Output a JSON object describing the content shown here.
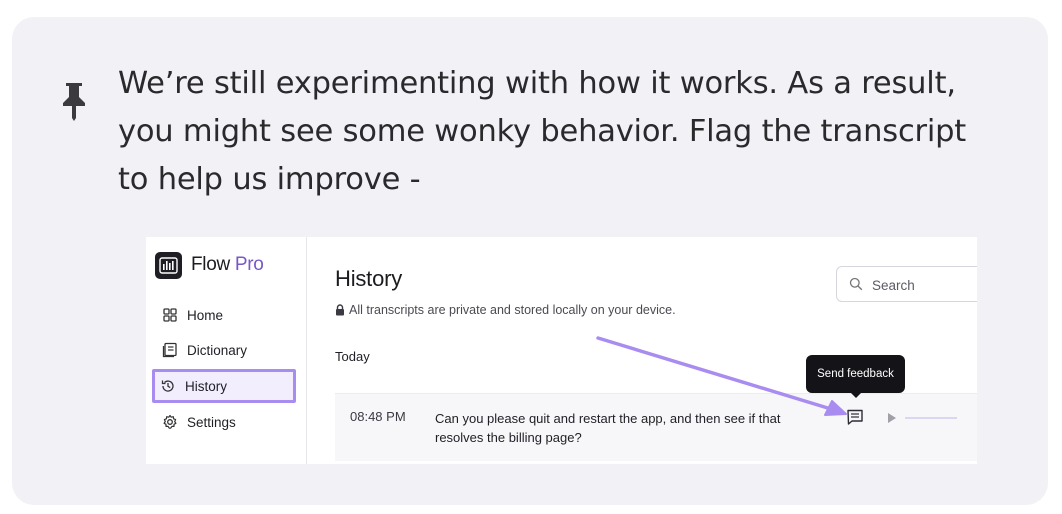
{
  "callout": {
    "icon": "pushpin-icon",
    "text": "We’re still experimenting with how it works. As a result, you might see some wonky behavior. Flag the transcript to help us improve -"
  },
  "app": {
    "brand_name": "Flow",
    "brand_suffix": "Pro",
    "brand_accent": "#7758c7"
  },
  "sidebar": {
    "items": [
      {
        "label": "Home",
        "icon": "grid-icon"
      },
      {
        "label": "Dictionary",
        "icon": "book-icon"
      },
      {
        "label": "History",
        "icon": "history-icon",
        "selected": true
      },
      {
        "label": "Settings",
        "icon": "gear-icon"
      }
    ]
  },
  "main": {
    "title": "History",
    "privacy_note": "All transcripts are private and stored locally on your device.",
    "search": {
      "placeholder": "Search"
    },
    "section": "Today",
    "rows": [
      {
        "time": "08:48 PM",
        "text": "Can you please quit and restart the app, and then see if that resolves the billing page?"
      }
    ]
  },
  "tooltip": {
    "text": "Send feedback"
  },
  "annotation": {
    "arrow_color": "#a98cf0",
    "highlight_color": "#a98cf0"
  }
}
